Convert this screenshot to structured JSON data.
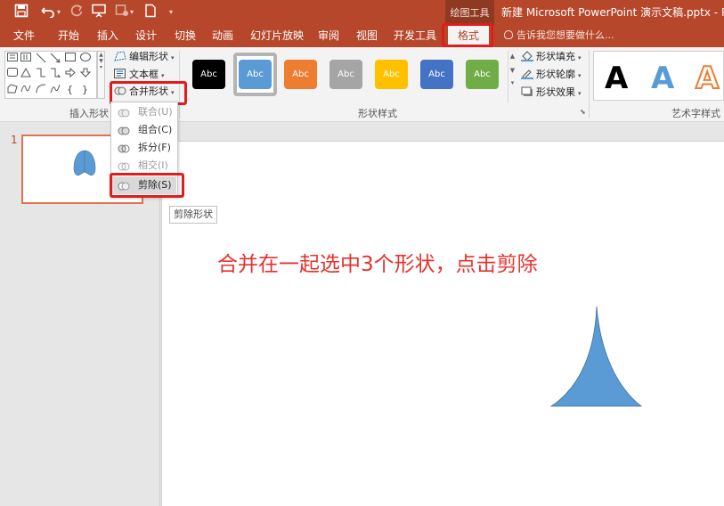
{
  "titlebar": {
    "context_tab": "绘图工具",
    "document_title": "新建 Microsoft PowerPoint 演示文稿.pptx - Power"
  },
  "tabs": [
    {
      "label": "文件"
    },
    {
      "label": "开始"
    },
    {
      "label": "插入"
    },
    {
      "label": "设计"
    },
    {
      "label": "切换"
    },
    {
      "label": "动画"
    },
    {
      "label": "幻灯片放映"
    },
    {
      "label": "审阅"
    },
    {
      "label": "视图"
    },
    {
      "label": "开发工具"
    },
    {
      "label": "格式"
    }
  ],
  "tell_me": "告诉我您想要做什么...",
  "ribbon": {
    "insert_shapes": {
      "group_label": "插入形状",
      "edit_shape": "编辑形状",
      "text_box": "文本框",
      "merge_shapes": "合并形状"
    },
    "shape_styles": {
      "group_label": "形状样式",
      "tiles": [
        {
          "label": "Abc",
          "color": "#000000"
        },
        {
          "label": "Abc",
          "color": "#5b9bd5"
        },
        {
          "label": "Abc",
          "color": "#ed7d31"
        },
        {
          "label": "Abc",
          "color": "#a5a5a5"
        },
        {
          "label": "Abc",
          "color": "#ffc000"
        },
        {
          "label": "Abc",
          "color": "#4472c4"
        },
        {
          "label": "Abc",
          "color": "#70ad47"
        }
      ],
      "fill": "形状填充",
      "outline": "形状轮廓",
      "effects": "形状效果"
    },
    "wordart": {
      "group_label": "艺术字样式",
      "samples": [
        {
          "label": "A",
          "color": "#000000"
        },
        {
          "label": "A",
          "color": "#5b9bd5"
        },
        {
          "label": "A",
          "color": "#ed7d31"
        }
      ]
    }
  },
  "merge_menu": {
    "items": [
      {
        "label": "联合(U)",
        "enabled": false
      },
      {
        "label": "组合(C)",
        "enabled": true
      },
      {
        "label": "拆分(F)",
        "enabled": true
      },
      {
        "label": "相交(I)",
        "enabled": false
      },
      {
        "label": "剪除(S)",
        "enabled": true
      }
    ]
  },
  "tooltip": "剪除形状",
  "slides": {
    "number": "1"
  },
  "slide": {
    "instruction": "合并在一起选中3个形状，点击剪除",
    "shape_color": "#5b9bd5"
  },
  "colors": {
    "accent": "#b7472a",
    "highlight": "#e21b1b",
    "instruction_text": "#e5322d"
  }
}
